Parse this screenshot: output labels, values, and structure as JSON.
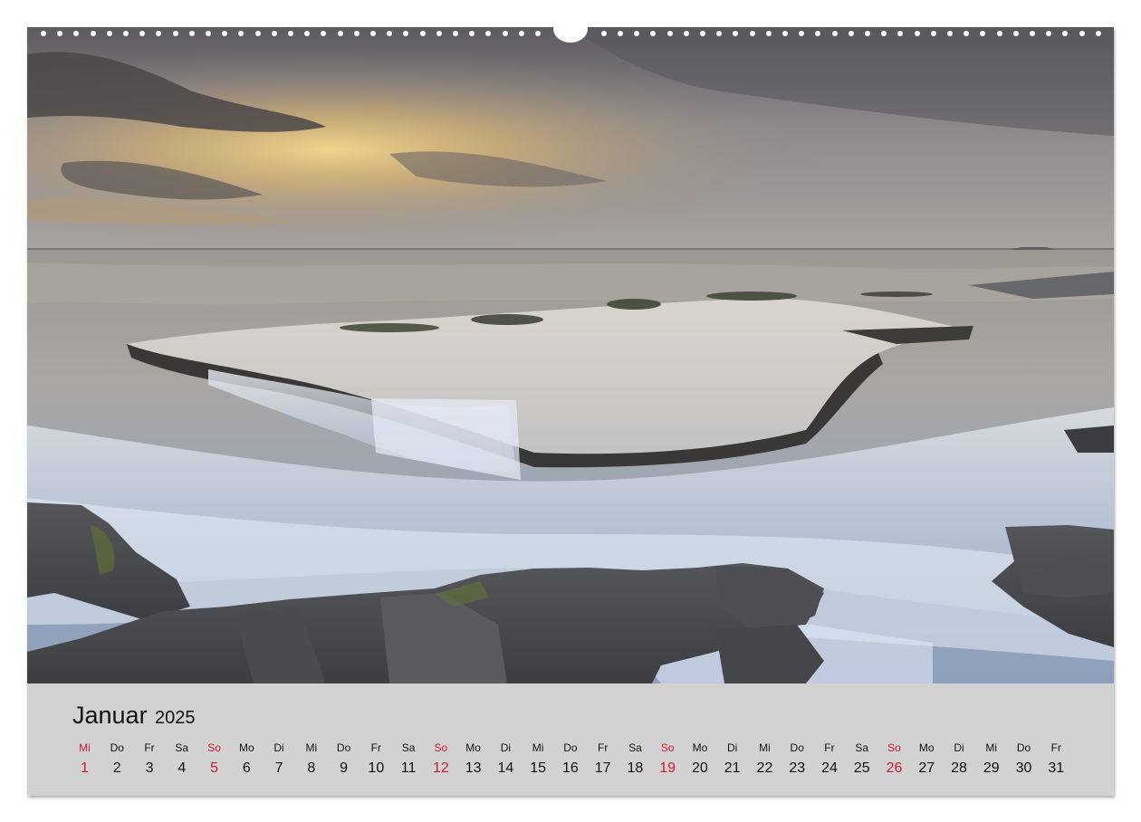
{
  "calendar": {
    "month_name": "Januar",
    "year": "2025",
    "days": [
      {
        "weekday": "Mi",
        "day": "1",
        "sunday": true
      },
      {
        "weekday": "Do",
        "day": "2",
        "sunday": false
      },
      {
        "weekday": "Fr",
        "day": "3",
        "sunday": false
      },
      {
        "weekday": "Sa",
        "day": "4",
        "sunday": false
      },
      {
        "weekday": "So",
        "day": "5",
        "sunday": true
      },
      {
        "weekday": "Mo",
        "day": "6",
        "sunday": false
      },
      {
        "weekday": "Di",
        "day": "7",
        "sunday": false
      },
      {
        "weekday": "Mi",
        "day": "8",
        "sunday": false
      },
      {
        "weekday": "Do",
        "day": "9",
        "sunday": false
      },
      {
        "weekday": "Fr",
        "day": "10",
        "sunday": false
      },
      {
        "weekday": "Sa",
        "day": "11",
        "sunday": false
      },
      {
        "weekday": "So",
        "day": "12",
        "sunday": true
      },
      {
        "weekday": "Mo",
        "day": "13",
        "sunday": false
      },
      {
        "weekday": "Di",
        "day": "14",
        "sunday": false
      },
      {
        "weekday": "Mi",
        "day": "15",
        "sunday": false
      },
      {
        "weekday": "Do",
        "day": "16",
        "sunday": false
      },
      {
        "weekday": "Fr",
        "day": "17",
        "sunday": false
      },
      {
        "weekday": "Sa",
        "day": "18",
        "sunday": false
      },
      {
        "weekday": "So",
        "day": "19",
        "sunday": true
      },
      {
        "weekday": "Mo",
        "day": "20",
        "sunday": false
      },
      {
        "weekday": "Di",
        "day": "21",
        "sunday": false
      },
      {
        "weekday": "Mi",
        "day": "22",
        "sunday": false
      },
      {
        "weekday": "Do",
        "day": "23",
        "sunday": false
      },
      {
        "weekday": "Fr",
        "day": "24",
        "sunday": false
      },
      {
        "weekday": "Sa",
        "day": "25",
        "sunday": false
      },
      {
        "weekday": "So",
        "day": "26",
        "sunday": true
      },
      {
        "weekday": "Mo",
        "day": "27",
        "sunday": false
      },
      {
        "weekday": "Di",
        "day": "28",
        "sunday": false
      },
      {
        "weekday": "Mi",
        "day": "29",
        "sunday": false
      },
      {
        "weekday": "Do",
        "day": "30",
        "sunday": false
      },
      {
        "weekday": "Fr",
        "day": "31",
        "sunday": false
      }
    ]
  },
  "colors": {
    "holiday_red": "#d0192c",
    "strip_gray": "#d2d2d2",
    "text_dark": "#111111"
  }
}
